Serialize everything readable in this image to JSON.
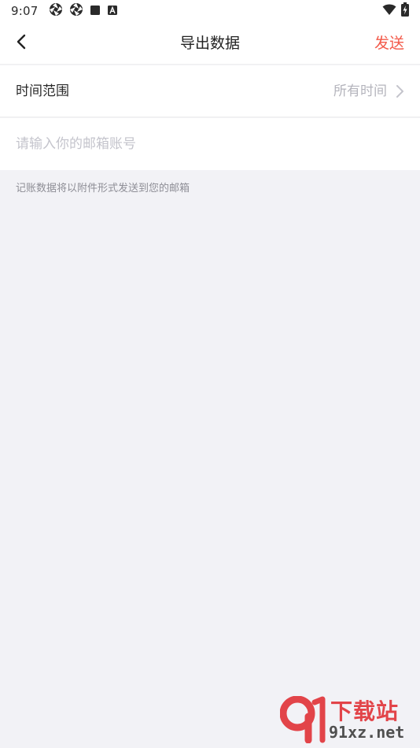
{
  "status_bar": {
    "time": "9:07",
    "left_icons": [
      "aperture-icon",
      "aperture-icon",
      "square-icon",
      "a-badge-icon"
    ],
    "right_icons": [
      "wifi-icon",
      "battery-charging-icon"
    ]
  },
  "nav": {
    "back_icon": "chevron-left-icon",
    "title": "导出数据",
    "send_label": "发送",
    "accent_color": "#f35a4a"
  },
  "time_range": {
    "label": "时间范围",
    "value": "所有时间",
    "icon": "chevron-right-icon"
  },
  "email": {
    "value": "",
    "placeholder": "请输入你的邮箱账号"
  },
  "hint": "记账数据将以附件形式发送到您的邮箱",
  "watermark": {
    "title": "下载站",
    "url": "91xz.net"
  }
}
